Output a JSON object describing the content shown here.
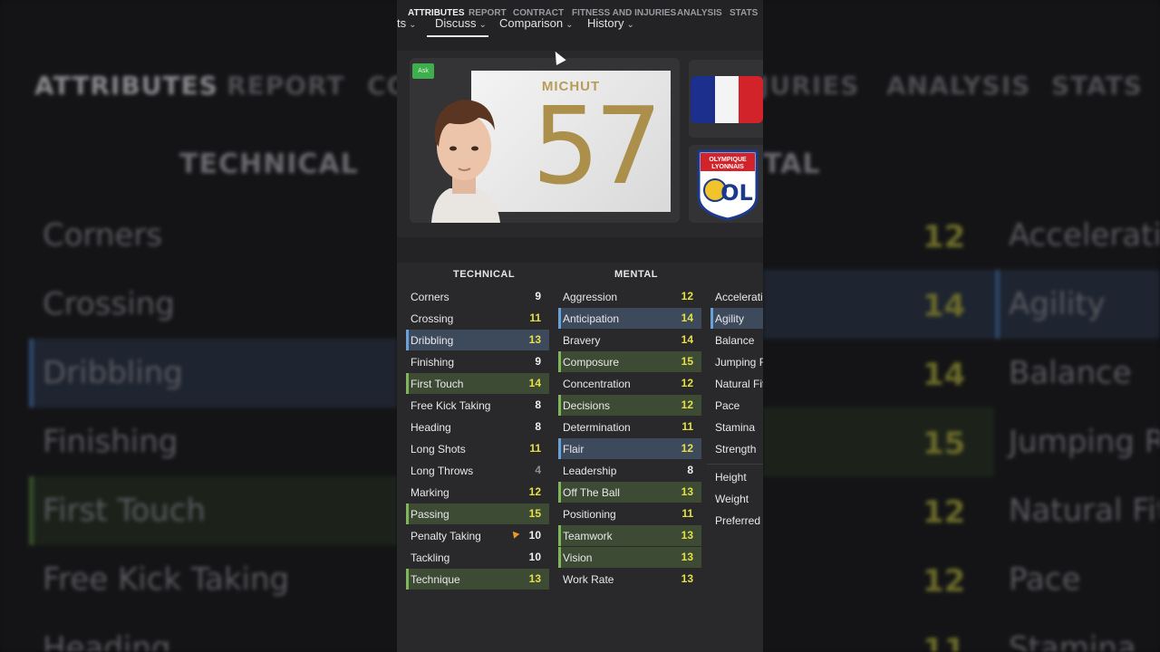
{
  "background": {
    "tabs": [
      "ATTRIBUTES",
      "REPORT",
      "CO",
      "JURIES",
      "ANALYSIS",
      "STATS"
    ],
    "headings": [
      "TECHNICAL",
      "TAL"
    ],
    "left_items": [
      "Corners",
      "Crossing",
      "Dribbling",
      "Finishing",
      "First Touch",
      "Free Kick Taking",
      "Heading"
    ],
    "right_items": [
      "Accelerati",
      "Agility",
      "Balance",
      "Jumping R",
      "Natural Fit",
      "Pace",
      "Stamina"
    ],
    "right_values": [
      "12",
      "14",
      "14",
      "15",
      "12",
      "12",
      "11"
    ]
  },
  "menu": [
    {
      "label": "ts"
    },
    {
      "label": "Discuss"
    },
    {
      "label": "Comparison"
    },
    {
      "label": "History"
    }
  ],
  "player": {
    "ask_label": "Ask",
    "shirt_name": "MICHUT",
    "shirt_number": "57",
    "club_text_1": "OLYMPIQUE",
    "club_text_2": "LYONNAIS",
    "club_monogram": "OL"
  },
  "colors": {
    "flag_blue": "#1d2f8c",
    "flag_white": "#f4f4f4",
    "flag_red": "#d2232a",
    "jersey_gold": "#ab8f4b",
    "value_yellow": "#e6e044",
    "value_green": "#7ed957"
  },
  "tabs": [
    "ATTRIBUTES",
    "REPORT",
    "CONTRACT",
    "FITNESS AND INJURIES",
    "ANALYSIS",
    "STATS"
  ],
  "headers": {
    "technical": "TECHNICAL",
    "mental": "MENTAL"
  },
  "technical": [
    {
      "label": "Corners",
      "value": "9"
    },
    {
      "label": "Crossing",
      "value": "11"
    },
    {
      "label": "Dribbling",
      "value": "13"
    },
    {
      "label": "Finishing",
      "value": "9"
    },
    {
      "label": "First Touch",
      "value": "14"
    },
    {
      "label": "Free Kick Taking",
      "value": "8"
    },
    {
      "label": "Heading",
      "value": "8"
    },
    {
      "label": "Long Shots",
      "value": "11"
    },
    {
      "label": "Long Throws",
      "value": "4"
    },
    {
      "label": "Marking",
      "value": "12"
    },
    {
      "label": "Passing",
      "value": "15"
    },
    {
      "label": "Penalty Taking",
      "value": "10"
    },
    {
      "label": "Tackling",
      "value": "10"
    },
    {
      "label": "Technique",
      "value": "13"
    }
  ],
  "mental": [
    {
      "label": "Aggression",
      "value": "12"
    },
    {
      "label": "Anticipation",
      "value": "14"
    },
    {
      "label": "Bravery",
      "value": "14"
    },
    {
      "label": "Composure",
      "value": "15"
    },
    {
      "label": "Concentration",
      "value": "12"
    },
    {
      "label": "Decisions",
      "value": "12"
    },
    {
      "label": "Determination",
      "value": "11"
    },
    {
      "label": "Flair",
      "value": "12"
    },
    {
      "label": "Leadership",
      "value": "8"
    },
    {
      "label": "Off The Ball",
      "value": "13"
    },
    {
      "label": "Positioning",
      "value": "11"
    },
    {
      "label": "Teamwork",
      "value": "13"
    },
    {
      "label": "Vision",
      "value": "13"
    },
    {
      "label": "Work Rate",
      "value": "13"
    }
  ],
  "physical": [
    {
      "label": "Accelerati"
    },
    {
      "label": "Agility"
    },
    {
      "label": "Balance"
    },
    {
      "label": "Jumping R"
    },
    {
      "label": "Natural Fit"
    },
    {
      "label": "Pace"
    },
    {
      "label": "Stamina"
    },
    {
      "label": "Strength"
    }
  ],
  "details": [
    "Height",
    "Weight",
    "Preferred"
  ]
}
